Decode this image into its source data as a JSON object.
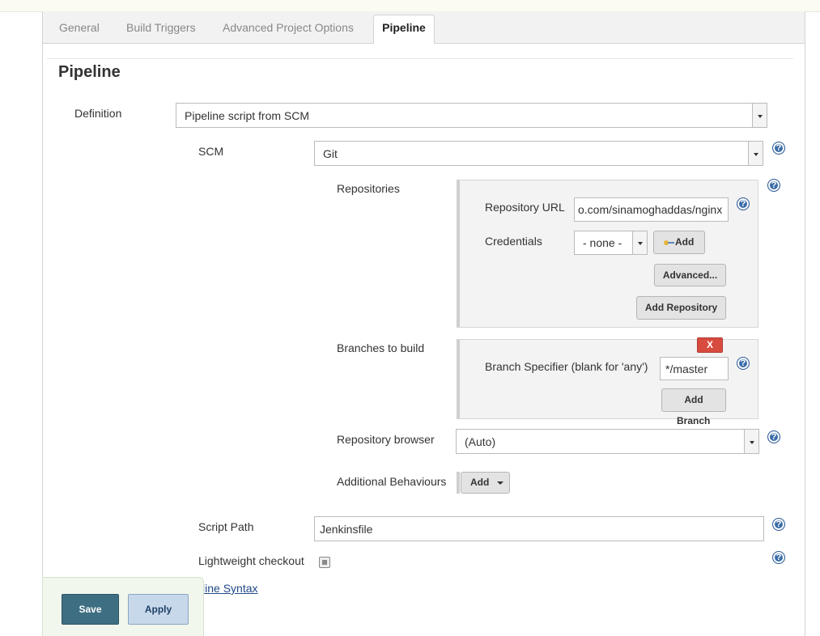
{
  "tabs": [
    {
      "label": "General"
    },
    {
      "label": "Build Triggers"
    },
    {
      "label": "Advanced Project Options"
    },
    {
      "label": "Pipeline"
    }
  ],
  "section_title": "Pipeline",
  "definition": {
    "label": "Definition",
    "value": "Pipeline script from SCM"
  },
  "scm": {
    "label": "SCM",
    "value": "Git"
  },
  "repositories": {
    "label": "Repositories",
    "url_label": "Repository URL",
    "url_value": "o.com/sinamoghaddas/nginx",
    "credentials_label": "Credentials",
    "credentials_value": "- none -",
    "add_credentials_label": "Add",
    "advanced_label": "Advanced...",
    "add_repository_label": "Add Repository"
  },
  "branches": {
    "label": "Branches to build",
    "delete_label": "X",
    "specifier_label": "Branch Specifier (blank for 'any')",
    "specifier_value": "*/master",
    "add_branch_label_1": "Add",
    "add_branch_label_2": "Branch"
  },
  "repository_browser": {
    "label": "Repository browser",
    "value": "(Auto)"
  },
  "additional_behaviours": {
    "label": "Additional Behaviours",
    "add_label": "Add"
  },
  "script_path": {
    "label": "Script Path",
    "value": "Jenkinsfile"
  },
  "lightweight_checkout": {
    "label": "Lightweight checkout",
    "checked": true
  },
  "pipeline_syntax_link": "Pipeline Syntax",
  "footer": {
    "save_label": "Save",
    "apply_label": "Apply"
  },
  "colors": {
    "accent_save": "#3e6e82",
    "apply": "#c7d8ea",
    "delete": "#d84b3f",
    "help": "#3b6da8"
  }
}
